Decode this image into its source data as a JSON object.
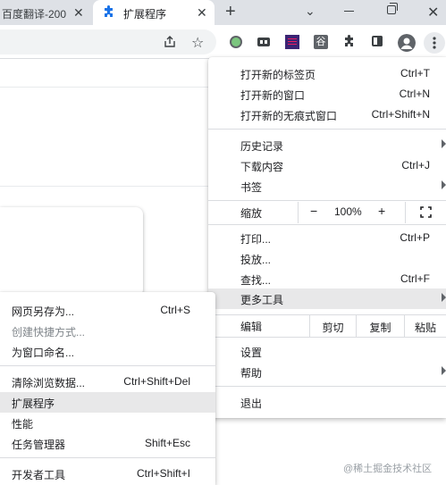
{
  "tabs": [
    {
      "title": "百度翻译-200",
      "close": "✕"
    },
    {
      "title": "扩展程序",
      "close": "✕"
    }
  ],
  "new_tab": "+",
  "tab_search": "⌄",
  "window_close": "✕",
  "extensions": {
    "gu_label": "谷"
  },
  "main_menu": {
    "new_tab": {
      "label": "打开新的标签页",
      "shortcut": "Ctrl+T"
    },
    "new_window": {
      "label": "打开新的窗口",
      "shortcut": "Ctrl+N"
    },
    "incognito": {
      "label": "打开新的无痕式窗口",
      "shortcut": "Ctrl+Shift+N"
    },
    "history": {
      "label": "历史记录"
    },
    "downloads": {
      "label": "下载内容",
      "shortcut": "Ctrl+J"
    },
    "bookmarks": {
      "label": "书签"
    },
    "zoom": {
      "label": "缩放",
      "minus": "−",
      "value": "100%",
      "plus": "+"
    },
    "print": {
      "label": "打印...",
      "shortcut": "Ctrl+P"
    },
    "cast": {
      "label": "投放..."
    },
    "find": {
      "label": "查找...",
      "shortcut": "Ctrl+F"
    },
    "more_tools": {
      "label": "更多工具"
    },
    "edit": {
      "label": "编辑",
      "cut": "剪切",
      "copy": "复制",
      "paste": "粘贴"
    },
    "settings": {
      "label": "设置"
    },
    "help": {
      "label": "帮助"
    },
    "exit": {
      "label": "退出"
    }
  },
  "sub_menu": {
    "save_as": {
      "label": "网页另存为...",
      "shortcut": "Ctrl+S"
    },
    "create_shortcut": {
      "label": "创建快捷方式..."
    },
    "name_window": {
      "label": "为窗口命名..."
    },
    "clear_data": {
      "label": "清除浏览数据...",
      "shortcut": "Ctrl+Shift+Del"
    },
    "extensions": {
      "label": "扩展程序"
    },
    "performance": {
      "label": "性能"
    },
    "task_manager": {
      "label": "任务管理器",
      "shortcut": "Shift+Esc"
    },
    "dev_tools": {
      "label": "开发者工具",
      "shortcut": "Ctrl+Shift+I"
    }
  },
  "watermark": "@稀土掘金技术社区",
  "colors": {
    "accent": "#1a73e8",
    "highlight": "#e8e8e9",
    "tabstrip": "#dee1e6"
  }
}
